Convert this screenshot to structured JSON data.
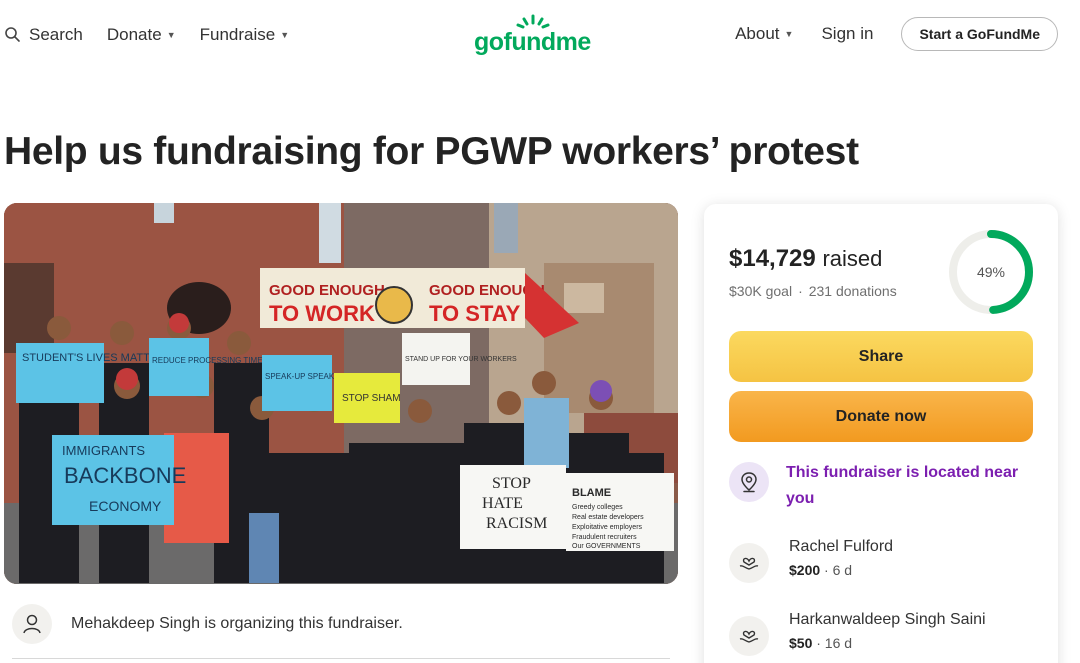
{
  "header": {
    "search_label": "Search",
    "donate_label": "Donate",
    "fundraise_label": "Fundraise",
    "logo_text": "gofundme",
    "about_label": "About",
    "signin_label": "Sign in",
    "start_label": "Start a GoFundMe"
  },
  "page": {
    "title": "Help us fundraising for PGWP workers’ protest"
  },
  "hero": {
    "banner_line1": "GOOD ENOUGH",
    "banner_line2": "TO WORK",
    "banner_line3": "GOOD ENOUGH",
    "banner_line4": "TO STAY",
    "sign1": "STUDENT'S LIVES MATTER",
    "sign2": "REDUCE PROCESSING TIME",
    "sign3": "SPEAK-UP SPEAK-BUT HEAR",
    "sign4": "STOP SHAM",
    "sign5": "STAND UP FOR YOUR WORKERS",
    "sign6_line1": "IMMIGRANTS",
    "sign6_line2": "BACKBONE",
    "sign6_line3": "ECONOMY",
    "sign7_line1": "STOP",
    "sign7_line2": "HATE",
    "sign7_line3": "RACISM",
    "sign8_line1": "BLAME",
    "sign8_line2": "Greedy colleges",
    "sign8_line3": "Real estate developers",
    "sign8_line4": "Exploitative employers",
    "sign8_line5": "Fraudulent recruiters",
    "sign8_line6": "Our GOVERNMENTS"
  },
  "organizer": {
    "text": "Mehakdeep Singh is organizing this fundraiser."
  },
  "card": {
    "amount": "$14,729",
    "raised_word": "raised",
    "goal": "$30K goal",
    "dot": "·",
    "donations": "231 donations",
    "percent_text": "49%",
    "percent": 0.49,
    "share_label": "Share",
    "donate_label": "Donate now",
    "near_text": "This fundraiser is located near you",
    "donors": [
      {
        "name": "Rachel Fulford",
        "amount": "$200",
        "time": "· 6 d"
      },
      {
        "name": "Harkanwaldeep Singh Saini",
        "amount": "$50",
        "time": "· 16 d"
      }
    ]
  },
  "colors": {
    "brand_green": "#02a95c",
    "share_yellow": "#f7cb4d",
    "donate_orange": "#f5a52e",
    "near_purple": "#7c1fb0"
  },
  "icons": [
    "search-icon",
    "chevron-down-icon",
    "user-icon",
    "location-pin-icon",
    "heart-hands-icon"
  ]
}
